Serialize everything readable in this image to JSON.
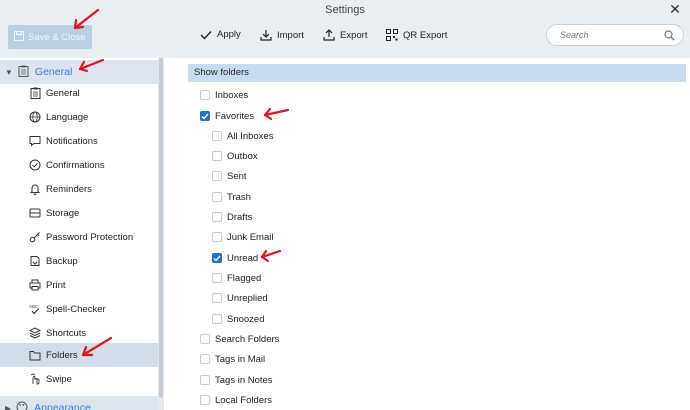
{
  "window": {
    "title": "Settings"
  },
  "toolbar": {
    "save_close_label": "Save & Close",
    "apply_label": "Apply",
    "import_label": "Import",
    "export_label": "Export",
    "qr_export_label": "QR Export",
    "search_placeholder": "Search"
  },
  "sidebar": {
    "sections": [
      {
        "label": "General",
        "expanded": true
      },
      {
        "label": "Appearance",
        "expanded": false
      }
    ],
    "items": [
      {
        "label": "General",
        "icon": "clipboard-icon"
      },
      {
        "label": "Language",
        "icon": "globe-icon"
      },
      {
        "label": "Notifications",
        "icon": "chat-bubble-icon"
      },
      {
        "label": "Confirmations",
        "icon": "check-circle-icon"
      },
      {
        "label": "Reminders",
        "icon": "bell-icon"
      },
      {
        "label": "Storage",
        "icon": "storage-icon"
      },
      {
        "label": "Password Protection",
        "icon": "key-icon"
      },
      {
        "label": "Backup",
        "icon": "backup-icon"
      },
      {
        "label": "Print",
        "icon": "printer-icon"
      },
      {
        "label": "Spell-Checker",
        "icon": "spellcheck-icon"
      },
      {
        "label": "Shortcuts",
        "icon": "shortcuts-icon"
      },
      {
        "label": "Folders",
        "icon": "folder-icon",
        "active": true
      },
      {
        "label": "Swipe",
        "icon": "swipe-hand-icon"
      }
    ]
  },
  "main": {
    "group_title": "Show folders",
    "options": [
      {
        "label": "Inboxes",
        "checked": false,
        "level": 0
      },
      {
        "label": "Favorites",
        "checked": true,
        "level": 0
      },
      {
        "label": "All Inboxes",
        "checked": false,
        "level": 1
      },
      {
        "label": "Outbox",
        "checked": false,
        "level": 1
      },
      {
        "label": "Sent",
        "checked": false,
        "level": 1
      },
      {
        "label": "Trash",
        "checked": false,
        "level": 1
      },
      {
        "label": "Drafts",
        "checked": false,
        "level": 1
      },
      {
        "label": "Junk Email",
        "checked": false,
        "level": 1
      },
      {
        "label": "Unread",
        "checked": true,
        "level": 1
      },
      {
        "label": "Flagged",
        "checked": false,
        "level": 1
      },
      {
        "label": "Unreplied",
        "checked": false,
        "level": 1
      },
      {
        "label": "Snoozed",
        "checked": false,
        "level": 1
      },
      {
        "label": "Search Folders",
        "checked": false,
        "level": 0
      },
      {
        "label": "Tags in Mail",
        "checked": false,
        "level": 0
      },
      {
        "label": "Tags in Notes",
        "checked": false,
        "level": 0
      },
      {
        "label": "Local Folders",
        "checked": false,
        "level": 0
      }
    ]
  },
  "colors": {
    "accent": "#1f6fd6",
    "section_text": "#3a7bd5",
    "group_header_bg": "#c7dbf2",
    "annotation_arrow": "#e0141e"
  }
}
